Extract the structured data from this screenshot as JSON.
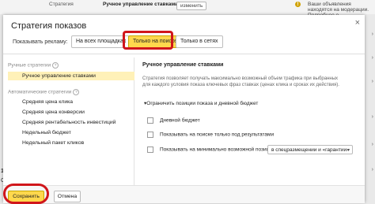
{
  "background": {
    "strategy_label": "Стратегия",
    "strategy_value": "Ручное управление ставками",
    "change_button": "изменить",
    "warning_icon": "!",
    "warning_text": "Ваши объявления находятся на модерации. Подробнее о",
    "left_number_1": "19",
    "left_number_2": "С",
    "right_chevrons": [
      "›",
      "›",
      "›",
      "›",
      "›",
      "›"
    ]
  },
  "modal": {
    "title": "Стратегия показов",
    "close_icon": "×",
    "show_label": "Показывать рекламу:",
    "tabs": [
      {
        "label": "На всех площадках",
        "selected": false
      },
      {
        "label": "Только на поиске",
        "selected": true
      },
      {
        "label": "Только в сетях",
        "selected": false
      }
    ],
    "manual_group": "Ручные стратегии",
    "manual_items": [
      "Ручное управление ставками"
    ],
    "auto_group": "Автоматические стратегии",
    "auto_items": [
      "Средняя цена клика",
      "Средняя цена конверсии",
      "Средняя рентабельность инвестиций",
      "Недельный бюджет",
      "Недельный пакет кликов"
    ],
    "selected_strategy_title": "Ручное управление ставками",
    "description": "Стратегия позволяет получать максимально возможный объем трафика при выбранных для каждого условия показа ключевых фраз ставках (ценах клика и сроках их действия).",
    "limit_label": "Ограничить позиции показа и дневной бюджет",
    "options": [
      "Дневной бюджет",
      "Показывать на поиске только под результатами",
      "Показывать на минимально возможной позиции"
    ],
    "position_select": "в спецразмещении и «гарантии»",
    "save_button": "Сохранить",
    "cancel_button": "Отмена"
  },
  "colors": {
    "accent_yellow": "#ffd84d",
    "highlight_red": "#d0161b",
    "selected_row": "#fff1b8"
  }
}
